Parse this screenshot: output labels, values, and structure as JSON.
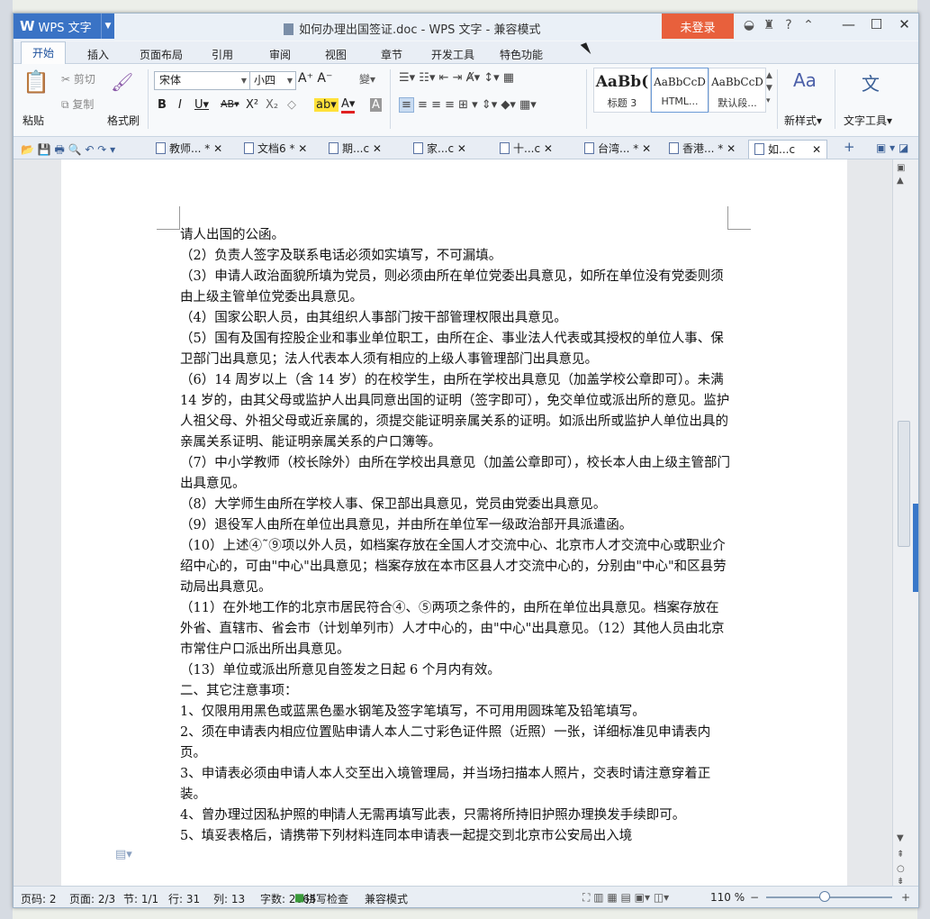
{
  "window": {
    "app_logo": "W",
    "app_name": "WPS 文字",
    "title": "如何办理出国签证.doc - WPS 文字 - 兼容模式",
    "login_label": "未登录"
  },
  "menu": [
    "开始",
    "插入",
    "页面布局",
    "引用",
    "审阅",
    "视图",
    "章节",
    "开发工具",
    "特色功能"
  ],
  "ribbon": {
    "paste": "粘贴",
    "cut": "剪切",
    "copy": "复制",
    "format_painter": "格式刷",
    "font": "宋体",
    "size": "小四",
    "styles": [
      {
        "preview": "AaBb(",
        "label": "标题 3"
      },
      {
        "preview": "AaBbCcD",
        "label": "HTML..."
      },
      {
        "preview": "AaBbCcD",
        "label": "默认段..."
      }
    ],
    "new_style": "新样式",
    "text_tools": "文字工具"
  },
  "tabs": [
    {
      "label": "教师...",
      "dirty": "*"
    },
    {
      "label": "文档6",
      "dirty": "*"
    },
    {
      "label": "期...c",
      "dirty": ""
    },
    {
      "label": "家...c",
      "dirty": ""
    },
    {
      "label": "十...c",
      "dirty": ""
    },
    {
      "label": "台湾...",
      "dirty": "*"
    },
    {
      "label": "香港...",
      "dirty": "*"
    },
    {
      "label": "如...c",
      "dirty": ""
    }
  ],
  "document": {
    "paragraphs": [
      "请人出国的公函。",
      "（2）负责人签字及联系电话必须如实填写，不可漏填。",
      "（3）申请人政治面貌所填为党员，则必须由所在单位党委出具意见，如所在单位没有党委则须由上级主管单位党委出具意见。",
      "（4）国家公职人员，由其组织人事部门按干部管理权限出具意见。",
      "（5）国有及国有控股企业和事业单位职工，由所在企、事业法人代表或其授权的单位人事、保卫部门出具意见；法人代表本人须有相应的上级人事管理部门出具意见。",
      "（6）14 周岁以上（含 14 岁）的在校学生，由所在学校出具意见（加盖学校公章即可）。未满 14 岁的，由其父母或监护人出具同意出国的证明（签字即可），免交单位或派出所的意见。监护人祖父母、外祖父母或近亲属的，须提交能证明亲属关系的证明。如派出所或监护人单位出具的亲属关系证明、能证明亲属关系的户口簿等。",
      "（7）中小学教师（校长除外）由所在学校出具意见（加盖公章即可），校长本人由上级主管部门出具意见。",
      "（8）大学师生由所在学校人事、保卫部出具意见，党员由党委出具意见。",
      "（9）退役军人由所在单位出具意见，并由所在单位军一级政治部开具派遣函。",
      "（10）上述④˜⑨项以外人员，如档案存放在全国人才交流中心、北京市人才交流中心或职业介绍中心的，可由\"中心\"出具意见；档案存放在本市区县人才交流中心的，分别由\"中心\"和区县劳动局出具意见。",
      "（11）在外地工作的北京市居民符合④、⑤两项之条件的，由所在单位出具意见。档案存放在外省、直辖市、省会市（计划单列市）人才中心的，由\"中心\"出具意见。（12）其他人员由北京市常住户口派出所出具意见。",
      "（13）单位或派出所意见自签发之日起 6 个月内有效。",
      "二、其它注意事项：",
      "1、仅限用用黑色或蓝黑色墨水钢笔及签字笔填写，不可用用圆珠笔及铅笔填写。",
      "2、须在申请表内相应位置贴申请人本人二寸彩色证件照（近照）一张，详细标准见申请表内页。",
      "3、申请表必须由申请人本人交至出入境管理局，并当场扫描本人照片，交表时请注意穿着正装。"
    ],
    "para_caret_before": "4、曾办理过因私护照的申",
    "para_caret_after": "请人无需再填写此表，只需将所持旧护照办理换发手续即可。",
    "para_cut": "5、填妥表格后，请携带下列材料连同本申请表一起提交到北京市公安局出入境"
  },
  "status": {
    "page_code": "页码: 2",
    "pages": "页面: 2/3",
    "section": "节: 1/1",
    "line": "行: 31",
    "col": "列: 13",
    "words": "字数: 2665",
    "spell": "拼写检查",
    "mode": "兼容模式",
    "zoom": "110 %"
  },
  "zoom_level": 110,
  "accent_color": "#3a73c5",
  "login_color": "#e8603c"
}
